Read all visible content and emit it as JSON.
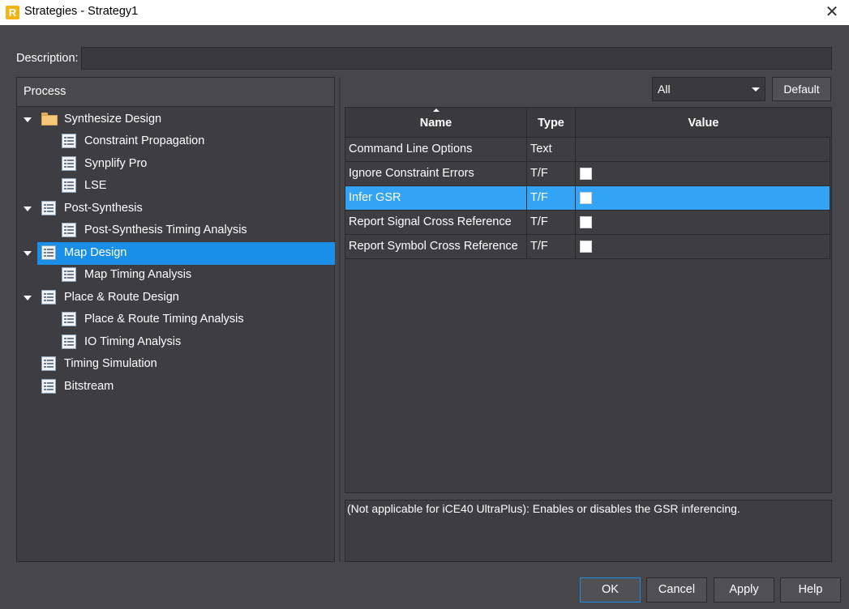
{
  "window": {
    "title": "Strategies - Strategy1",
    "app_icon_letter": "R",
    "close_glyph": "✕"
  },
  "description": {
    "label": "Description:",
    "value": ""
  },
  "process": {
    "header": "Process",
    "items": [
      {
        "label": "Synthesize Design",
        "level": 0,
        "expanded": true,
        "icon": "folder-icon"
      },
      {
        "label": "Constraint Propagation",
        "level": 1,
        "icon": "list-icon"
      },
      {
        "label": "Synplify Pro",
        "level": 1,
        "icon": "list-icon"
      },
      {
        "label": "LSE",
        "level": 1,
        "icon": "list-icon"
      },
      {
        "label": "Post-Synthesis",
        "level": 0,
        "expanded": true,
        "icon": "list-icon"
      },
      {
        "label": "Post-Synthesis Timing Analysis",
        "level": 1,
        "icon": "list-icon"
      },
      {
        "label": "Map Design",
        "level": 0,
        "expanded": true,
        "selected": true,
        "icon": "list-icon"
      },
      {
        "label": "Map Timing Analysis",
        "level": 1,
        "icon": "list-icon"
      },
      {
        "label": "Place & Route Design",
        "level": 0,
        "expanded": true,
        "icon": "list-icon"
      },
      {
        "label": "Place & Route Timing Analysis",
        "level": 1,
        "icon": "list-icon"
      },
      {
        "label": "IO Timing Analysis",
        "level": 1,
        "icon": "list-icon"
      },
      {
        "label": "Timing Simulation",
        "level": 0,
        "icon": "list-icon"
      },
      {
        "label": "Bitstream",
        "level": 0,
        "icon": "list-icon"
      }
    ]
  },
  "filter": {
    "selected": "All"
  },
  "default_button": "Default",
  "table": {
    "columns": [
      "Name",
      "Type",
      "Value"
    ],
    "rows": [
      {
        "name": "Command Line Options",
        "type": "Text",
        "value": "",
        "kind": "text"
      },
      {
        "name": "Ignore Constraint Errors",
        "type": "T/F",
        "value": false,
        "kind": "checkbox"
      },
      {
        "name": "Infer GSR",
        "type": "T/F",
        "value": false,
        "kind": "checkbox",
        "selected": true
      },
      {
        "name": "Report Signal Cross Reference",
        "type": "T/F",
        "value": false,
        "kind": "checkbox"
      },
      {
        "name": "Report Symbol Cross Reference",
        "type": "T/F",
        "value": false,
        "kind": "checkbox"
      }
    ]
  },
  "help_text": "(Not applicable for iCE40 UltraPlus): Enables or disables the GSR inferencing.",
  "buttons": {
    "ok": "OK",
    "cancel": "Cancel",
    "apply": "Apply",
    "help": "Help"
  },
  "colors": {
    "background": "#474649",
    "panel": "#3e3d41",
    "selection": "#1a8fe8",
    "row_selection": "#33a3f5"
  }
}
